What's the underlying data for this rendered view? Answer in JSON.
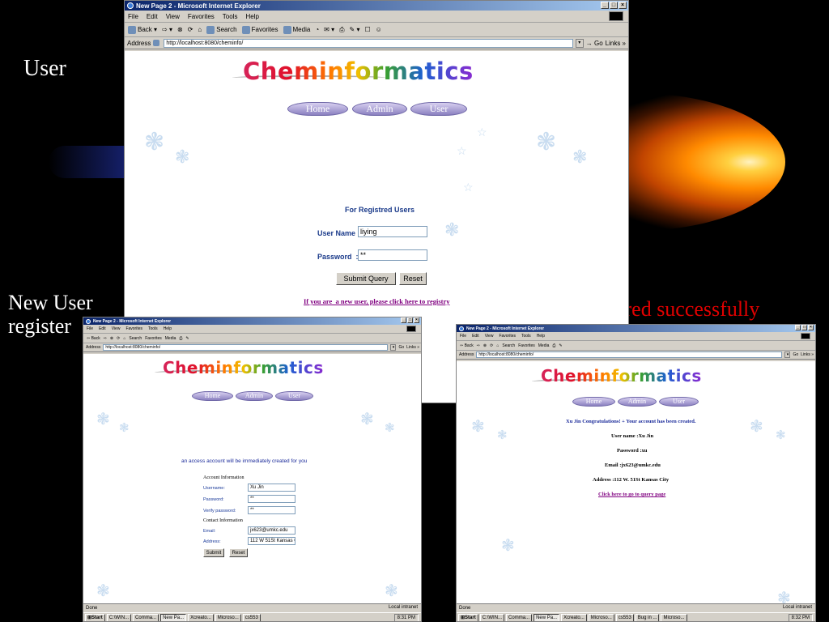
{
  "slide": {
    "label_user": "User",
    "label_new_user_line1": "New User",
    "label_new_user_line2": "register",
    "label_success": "New User registered successfully"
  },
  "browser": {
    "title": "New Page 2 - Microsoft Internet Explorer",
    "menu": [
      "File",
      "Edit",
      "View",
      "Favorites",
      "Tools",
      "Help"
    ],
    "toolbar": [
      "Back",
      "Search",
      "Favorites",
      "Media"
    ],
    "address_label": "Address",
    "url": "http://localhost:8080/cheminfo/",
    "go_label": "Go",
    "links_label": "Links",
    "status_done": "Done",
    "status_zone": "Local intranet"
  },
  "site": {
    "logo": "Cheminformatics",
    "nav": [
      "Home",
      "Admin",
      "User"
    ]
  },
  "login": {
    "heading": "For Registred Users",
    "username_label": "User Name :",
    "username_value": "liying",
    "password_label": "Password  :",
    "password_value": "**",
    "submit": "Submit Query",
    "reset": "Reset",
    "register_link": "If you are  a new user, please click here to registry"
  },
  "register": {
    "heading": "an access account will be immediately created for you",
    "account_section": "Account Information",
    "username_label": "Username:",
    "username_value": "Xu Jin",
    "password_label": "Password:",
    "password_value": "**",
    "verify_label": "Verify password:",
    "verify_value": "**",
    "contact_section": "Contact Information",
    "email_label": "Email:",
    "email_value": "jx623@umkc.edu",
    "address_label": "Address:",
    "address_value": "112 W 51St Kansas Cit",
    "submit": "Submit",
    "reset": "Reset"
  },
  "success": {
    "message": "Xu Jin Congratulations! + Your account has been created.",
    "username": "User name :Xu Jin",
    "password": "Password :xu",
    "email": "Email :jx623@umkc.edu",
    "address": "Address :112 W. 51St Kansas City",
    "query_link": "Click here to go to query page"
  },
  "taskbar": {
    "start": "Start",
    "tasks": [
      "C:\\WIN...",
      "Comma...",
      "New Pa...",
      "Xcreato...",
      "Microso...",
      "cs553",
      "Bug in ...",
      "Microso..."
    ],
    "clock_left": "8:31 PM",
    "clock_right": "8:32 PM"
  },
  "colors": {
    "slide_bg": "#000000",
    "success_label": "#e00000",
    "heading_blue": "#1a3a8a",
    "link_purple": "#800080"
  }
}
